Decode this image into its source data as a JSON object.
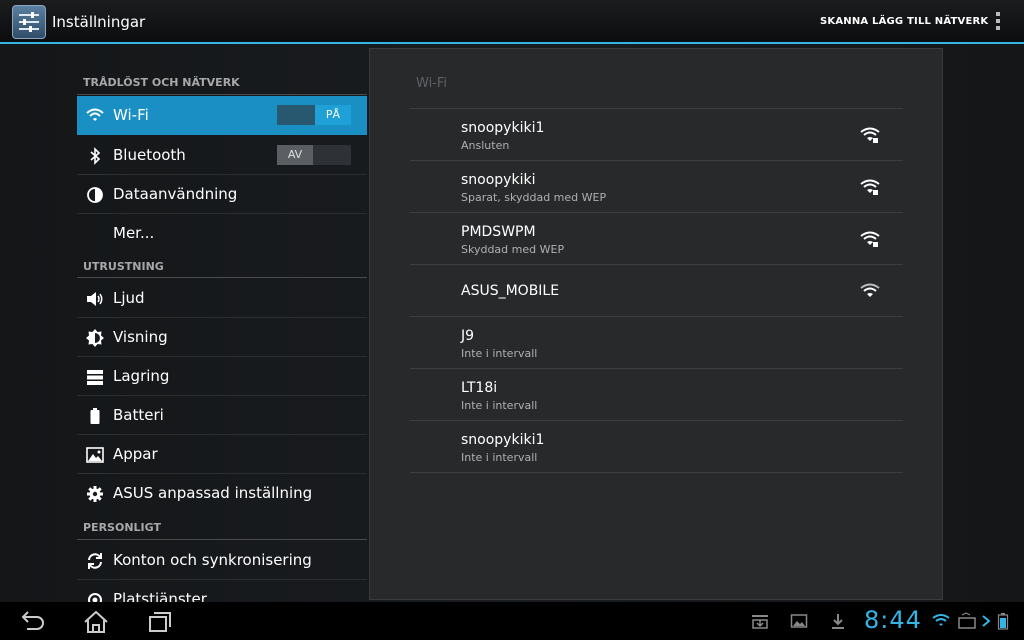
{
  "app": {
    "title": "Inställningar"
  },
  "actions": {
    "scan": "SKANNA",
    "add_network": "LÄGG TILL NÄTVERK"
  },
  "sidebar": {
    "sections": [
      "TRÅDLÖST OCH NÄTVERK",
      "UTRUSTNING",
      "PERSONLIGT"
    ],
    "items": [
      {
        "label": "Wi-Fi",
        "icon": "wifi-icon",
        "selected": true,
        "toggle": "PÅ"
      },
      {
        "label": "Bluetooth",
        "icon": "bluetooth-icon",
        "toggle": "AV"
      },
      {
        "label": "Dataanvändning",
        "icon": "data-usage-icon"
      },
      {
        "label": "Mer..."
      },
      {
        "label": "Ljud",
        "icon": "speaker-icon"
      },
      {
        "label": "Visning",
        "icon": "brightness-icon"
      },
      {
        "label": "Lagring",
        "icon": "storage-icon"
      },
      {
        "label": "Batteri",
        "icon": "battery-icon"
      },
      {
        "label": "Appar",
        "icon": "apps-icon"
      },
      {
        "label": "ASUS anpassad inställning",
        "icon": "gear-icon"
      },
      {
        "label": "Konton och synkronisering",
        "icon": "sync-icon"
      },
      {
        "label": "Platstjänster",
        "icon": "location-icon"
      }
    ]
  },
  "wifi_panel": {
    "title": "Wi-Fi",
    "networks": [
      {
        "ssid": "snoopykiki1",
        "status": "Ansluten",
        "secured": true,
        "in_range": true
      },
      {
        "ssid": "snoopykiki",
        "status": "Sparat, skyddad med WEP",
        "secured": true,
        "in_range": true
      },
      {
        "ssid": "PMDSWPM",
        "status": "Skyddad med WEP",
        "secured": true,
        "in_range": true
      },
      {
        "ssid": "ASUS_MOBILE",
        "status": "",
        "secured": false,
        "in_range": true
      },
      {
        "ssid": "J9",
        "status": "Inte i intervall",
        "in_range": false
      },
      {
        "ssid": "LT18i",
        "status": "Inte i intervall",
        "in_range": false
      },
      {
        "ssid": "snoopykiki1",
        "status": "Inte i intervall",
        "in_range": false
      }
    ]
  },
  "statusbar": {
    "time": "8:44"
  },
  "colors": {
    "accent": "#33b5e5",
    "selected": "#1a8fc4"
  }
}
